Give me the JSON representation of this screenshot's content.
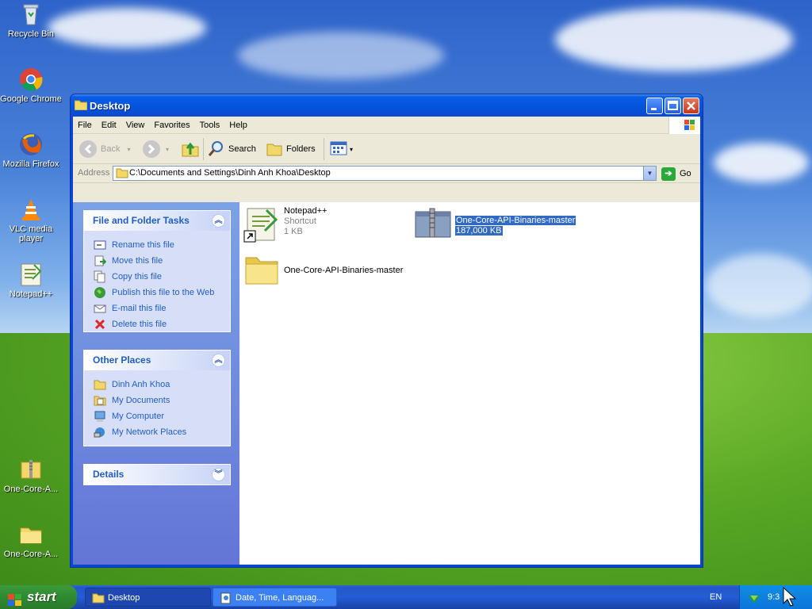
{
  "desktop": {
    "icons": [
      {
        "label": "Recycle Bin",
        "icon": "recycle-bin-icon"
      },
      {
        "label": "Google Chrome",
        "icon": "chrome-icon"
      },
      {
        "label": "Mozilla Firefox",
        "icon": "firefox-icon"
      },
      {
        "label": "VLC media player",
        "icon": "vlc-icon"
      },
      {
        "label": "Notepad++",
        "icon": "notepadpp-icon"
      },
      {
        "label": "One-Core-A...",
        "icon": "zip-folder-icon"
      },
      {
        "label": "One-Core-A...",
        "icon": "folder-icon"
      }
    ]
  },
  "window": {
    "title": "Desktop",
    "menu": [
      "File",
      "Edit",
      "View",
      "Favorites",
      "Tools",
      "Help"
    ],
    "toolbar": {
      "back": "Back",
      "search": "Search",
      "folders": "Folders"
    },
    "address": {
      "label": "Address",
      "value": "C:\\Documents and Settings\\Dinh Anh Khoa\\Desktop",
      "go": "Go"
    },
    "tasks_panel": {
      "title": "File and Folder Tasks",
      "items": [
        "Rename this file",
        "Move this file",
        "Copy this file",
        "Publish this file to the Web",
        "E-mail this file",
        "Delete this file"
      ]
    },
    "places_panel": {
      "title": "Other Places",
      "items": [
        "Dinh Anh Khoa",
        "My Documents",
        "My Computer",
        "My Network Places"
      ]
    },
    "details_panel": {
      "title": "Details"
    },
    "files": [
      {
        "name": "Notepad++",
        "type": "Shortcut",
        "size": "1 KB"
      },
      {
        "name": "One-Core-API-Binaries-master",
        "size": "187,000 KB",
        "selected": true
      },
      {
        "name": "One-Core-API-Binaries-master"
      }
    ]
  },
  "taskbar": {
    "start": "start",
    "tasks": [
      "Desktop",
      "Date, Time, Languag..."
    ],
    "lang": "EN",
    "clock": "9:3"
  },
  "colors": {
    "selection": "#316ac5",
    "title_blue": "#0a5ce6",
    "link_blue": "#215dc6"
  }
}
